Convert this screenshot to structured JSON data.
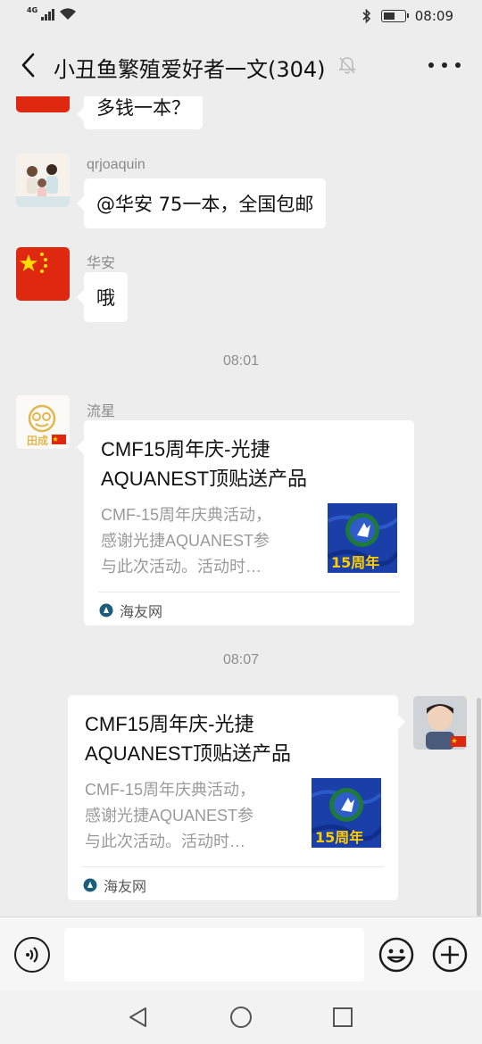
{
  "status_bar": {
    "network": "4G",
    "time": "08:09",
    "battery_level": 0.55
  },
  "header": {
    "title": "小丑鱼繁殖爱好者一文(304)"
  },
  "messages": [
    {
      "type": "text",
      "text": "多钱一本？"
    },
    {
      "type": "text",
      "sender": "qrjoaquin",
      "text": "@华安  75一本，全国包邮"
    },
    {
      "type": "text",
      "sender": "华安",
      "text": "哦"
    },
    {
      "type": "time",
      "text": "08:01"
    },
    {
      "type": "card",
      "sender": "流星",
      "title": "CMF15周年庆-光捷\nAQUANEST顶贴送产品",
      "description": "CMF-15周年庆典活动，\n感谢光捷AQUANEST参\n与此次活动。活动时…",
      "thumb_text": "15周年",
      "source": "海友网"
    },
    {
      "type": "time",
      "text": "08:07"
    },
    {
      "type": "card",
      "sender": "me",
      "title": "CMF15周年庆-光捷\nAQUANEST顶贴送产品",
      "description": "CMF-15周年庆典活动，\n感谢光捷AQUANEST参\n与此次活动。活动时…",
      "thumb_text": "15周年",
      "source": "海友网"
    }
  ],
  "avatar_labels": {
    "liuxing": "田成"
  },
  "colors": {
    "background": "#ededed",
    "bubble": "#ffffff",
    "flag_red": "#de2910",
    "flag_yellow": "#ffde00",
    "thumb_blue": "#1a3fa8",
    "source_icon": "#1b5e7a"
  },
  "icons": [
    "back-arrow",
    "mute-bell",
    "more-dots",
    "voice",
    "emoji",
    "plus",
    "nav-back",
    "nav-home",
    "nav-recent"
  ]
}
